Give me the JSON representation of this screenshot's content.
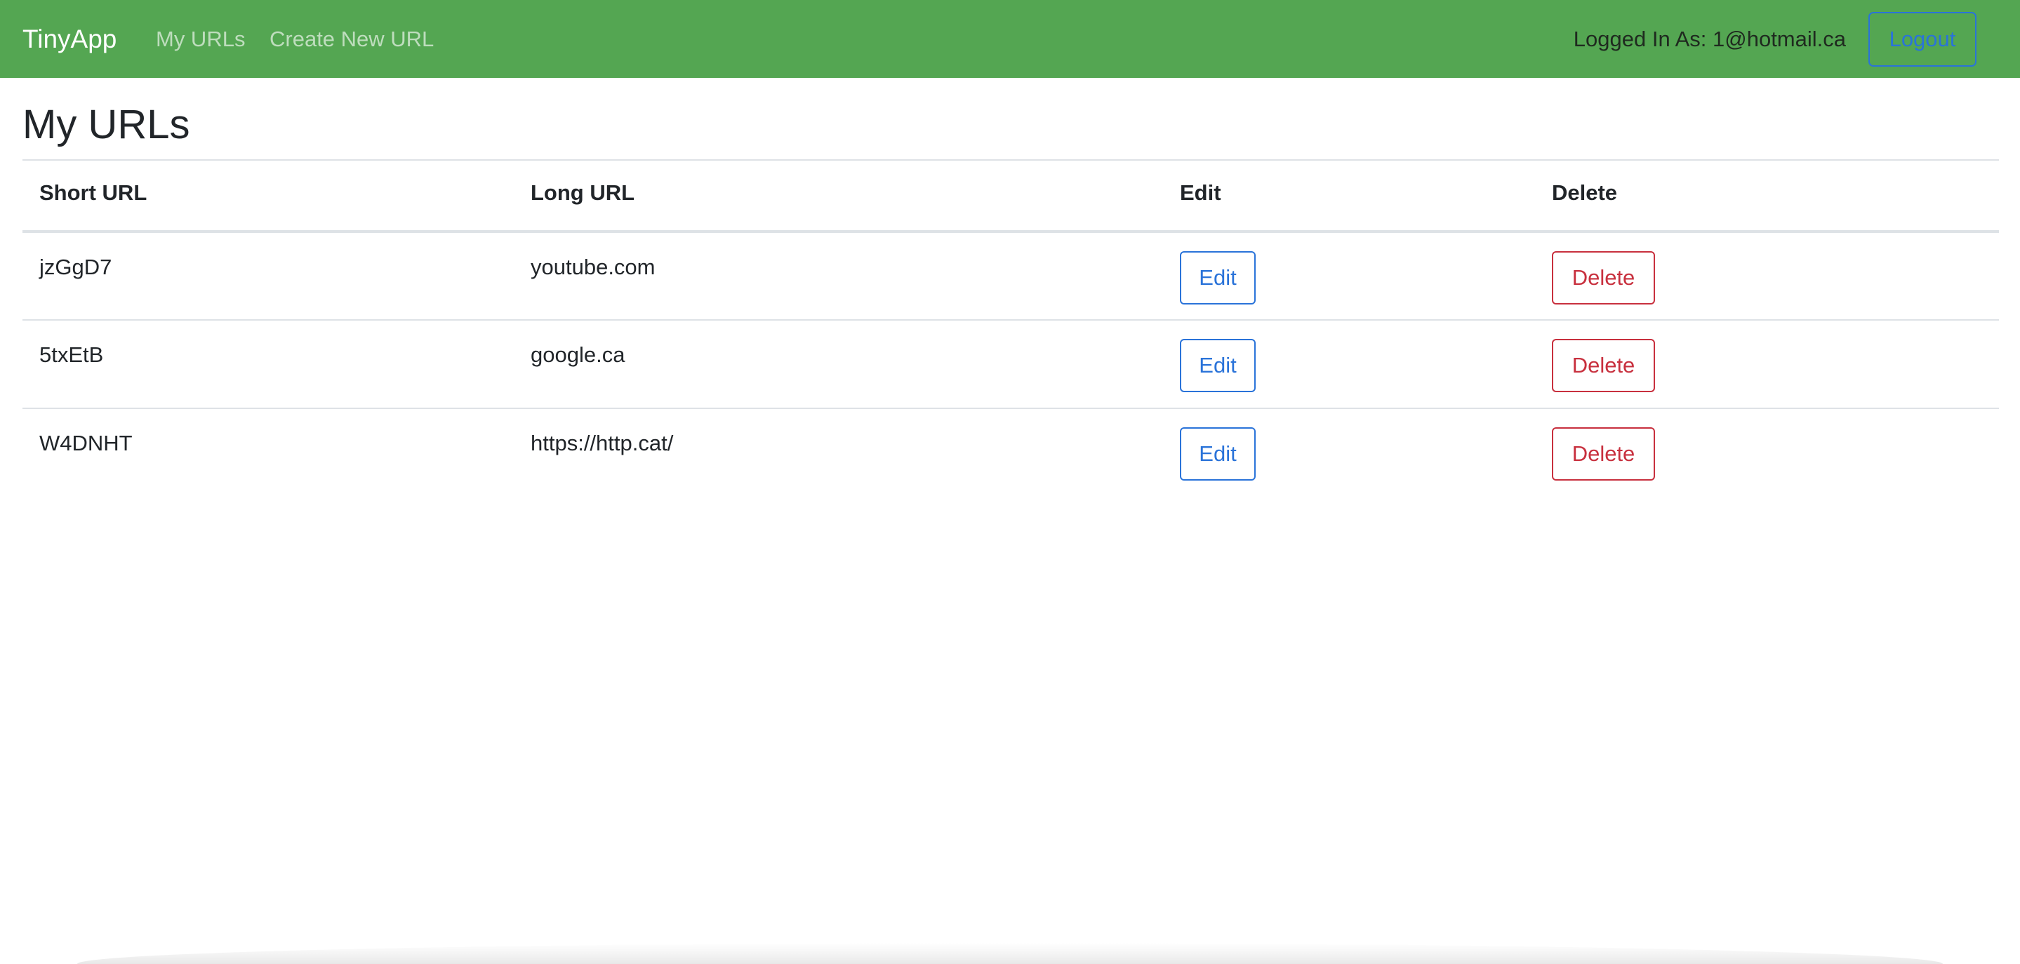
{
  "navbar": {
    "brand": "TinyApp",
    "links": [
      {
        "label": "My URLs"
      },
      {
        "label": "Create New URL"
      }
    ],
    "logged_in_text": "Logged In As: 1@hotmail.ca",
    "logout_label": "Logout",
    "background_color": "#54a652"
  },
  "main": {
    "title": "My URLs",
    "table": {
      "headers": [
        "Short URL",
        "Long URL",
        "Edit",
        "Delete"
      ],
      "rows": [
        {
          "short_url": "jzGgD7",
          "long_url": "youtube.com",
          "edit_label": "Edit",
          "delete_label": "Delete"
        },
        {
          "short_url": "5txEtB",
          "long_url": "google.ca",
          "edit_label": "Edit",
          "delete_label": "Delete"
        },
        {
          "short_url": "W4DNHT",
          "long_url": "https://http.cat/",
          "edit_label": "Edit",
          "delete_label": "Delete"
        }
      ]
    }
  },
  "colors": {
    "primary": "#2a73d9",
    "danger": "#c8303e"
  }
}
